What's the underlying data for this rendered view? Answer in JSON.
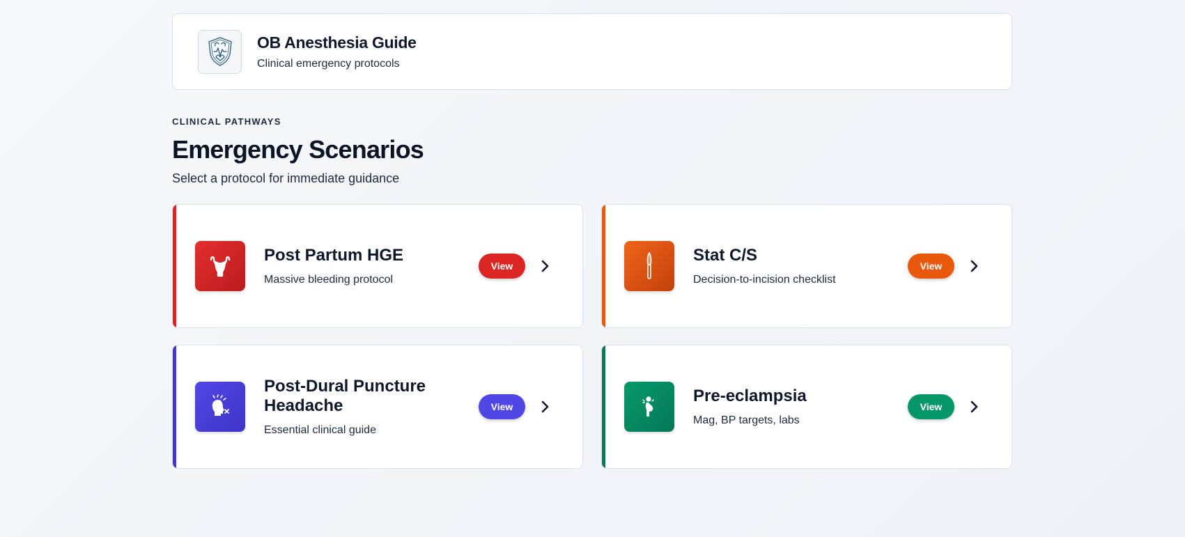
{
  "header": {
    "logo_icon": "medical-shield-logo-icon",
    "title": "OB Anesthesia Guide",
    "subtitle": "Clinical emergency protocols"
  },
  "section": {
    "eyebrow": "CLINICAL PATHWAYS",
    "title": "Emergency Scenarios",
    "subtitle": "Select a protocol for immediate guidance"
  },
  "cards": [
    {
      "title": "Post Partum HGE",
      "description": "Massive bleeding protocol",
      "button": "View",
      "icon": "uterus-icon",
      "color": "#dc2626"
    },
    {
      "title": "Stat C/S",
      "description": "Decision-to-incision checklist",
      "button": "View",
      "icon": "scalpel-icon",
      "color": "#ea580c"
    },
    {
      "title": "Post-Dural Puncture Headache",
      "description": "Essential clinical guide",
      "button": "View",
      "icon": "headache-icon",
      "color": "#4f46e5"
    },
    {
      "title": "Pre-eclampsia",
      "description": "Mag, BP targets, labs",
      "button": "View",
      "icon": "pregnant-woman-icon",
      "color": "#059669"
    }
  ]
}
